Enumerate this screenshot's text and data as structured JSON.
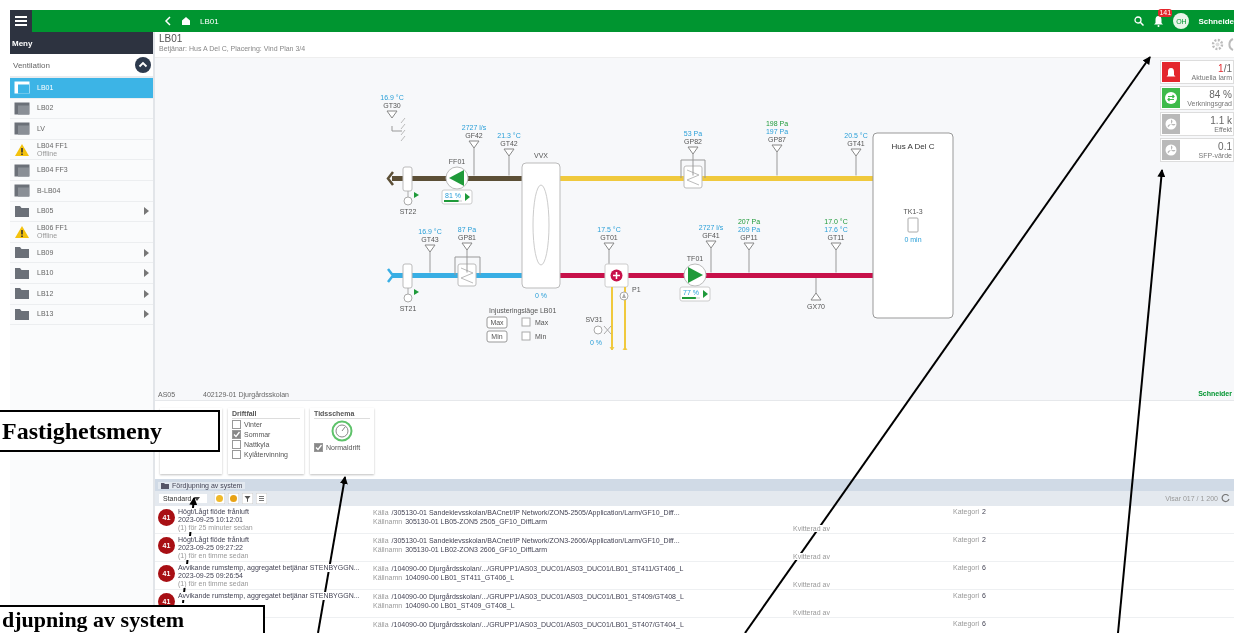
{
  "header": {
    "crumb": "LB01",
    "alarm_count": "141",
    "user_initials": "OH",
    "brand": "Schneide"
  },
  "sidebar": {
    "title": "Meny",
    "section": {
      "label": "Ventilation",
      "expanded": true
    },
    "items": [
      {
        "label": "LB01",
        "kind": "unit",
        "selected": true
      },
      {
        "label": "LB02",
        "kind": "unit",
        "selected": false
      },
      {
        "label": "LV",
        "kind": "unit",
        "selected": false
      },
      {
        "label": "LB04 FF1",
        "kind": "warning",
        "status": "Offline",
        "selected": false
      },
      {
        "label": "LB04 FF3",
        "kind": "unit",
        "selected": false
      },
      {
        "label": "B-LB04",
        "kind": "unit",
        "selected": false
      },
      {
        "label": "LB05",
        "kind": "folder",
        "selected": false
      },
      {
        "label": "LB06 FF1",
        "kind": "warning",
        "status": "Offline",
        "selected": false
      },
      {
        "label": "LB09",
        "kind": "folder",
        "selected": false
      },
      {
        "label": "LB10",
        "kind": "folder",
        "selected": false
      },
      {
        "label": "LB12",
        "kind": "folder",
        "selected": false
      },
      {
        "label": "LB13",
        "kind": "folder",
        "selected": false
      }
    ]
  },
  "page": {
    "title": "LB01",
    "subtitle": "Betjänar: Hus A Del C, Placering: Vind Plan 3/4"
  },
  "kpis": [
    {
      "kind": "alarm",
      "count": "1",
      "total": "/1",
      "label": "Aktuella larm"
    },
    {
      "kind": "recovery",
      "total": "84 %",
      "label": "Verkningsgrad"
    },
    {
      "kind": "fan",
      "total": "1.1 k",
      "label": "Effekt"
    },
    {
      "kind": "fan",
      "total": "0.1",
      "label": "SFP-värde"
    }
  ],
  "diagram": {
    "sensors": [
      {
        "tag": "GT30",
        "readings": [
          {
            "text": "16.9 °C",
            "kind": "measured"
          }
        ]
      },
      {
        "tag": "GF42",
        "readings": [
          {
            "text": "2727 l/s",
            "kind": "measured"
          }
        ]
      },
      {
        "tag": "GT42",
        "readings": [
          {
            "text": "21.3 °C",
            "kind": "measured"
          }
        ]
      },
      {
        "tag": "GP82",
        "readings": [
          {
            "text": "53 Pa",
            "kind": "measured"
          }
        ]
      },
      {
        "tag": "GP87",
        "readings": [
          {
            "text": "198 Pa",
            "kind": "setpoint"
          },
          {
            "text": "197 Pa",
            "kind": "measured"
          }
        ]
      },
      {
        "tag": "GT41",
        "readings": [
          {
            "text": "20.5 °C",
            "kind": "measured"
          }
        ]
      },
      {
        "tag": "GT43",
        "readings": [
          {
            "text": "16.9 °C",
            "kind": "measured"
          }
        ]
      },
      {
        "tag": "GP81",
        "readings": [
          {
            "text": "87 Pa",
            "kind": "measured"
          }
        ]
      },
      {
        "tag": "GT01",
        "readings": [
          {
            "text": "17.5 °C",
            "kind": "measured"
          }
        ]
      },
      {
        "tag": "GF41",
        "readings": [
          {
            "text": "2727 l/s",
            "kind": "measured"
          }
        ]
      },
      {
        "tag": "GP11",
        "readings": [
          {
            "text": "207 Pa",
            "kind": "setpoint"
          },
          {
            "text": "209 Pa",
            "kind": "measured"
          }
        ]
      },
      {
        "tag": "GT11",
        "readings": [
          {
            "text": "17.0 °C",
            "kind": "setpoint"
          },
          {
            "text": "17.6 °C",
            "kind": "measured"
          }
        ]
      }
    ],
    "fans": [
      {
        "tag": "FF01",
        "speed": "81 %",
        "level": 0.81
      },
      {
        "tag": "TF01",
        "speed": "77 %",
        "level": 0.77
      }
    ],
    "dampers": [
      {
        "tag": "ST22"
      },
      {
        "tag": "ST21"
      }
    ],
    "exchanger": {
      "tag": "VVX",
      "output": "0 %"
    },
    "valve": {
      "tag": "SV31",
      "output": "0 %"
    },
    "pump": {
      "tag": "P1"
    },
    "pressure_sensor": {
      "tag": "GX70"
    },
    "zone": {
      "name": "Hus A Del C",
      "tag": "TK1-3",
      "time": "0 min"
    },
    "balancing": {
      "title": "Injusteringsläge LB01",
      "buttons": [
        "Max",
        "Min"
      ],
      "options": [
        {
          "label": "Max",
          "checked": false
        },
        {
          "label": "Min",
          "checked": false
        }
      ]
    },
    "footer": [
      "AS05",
      "402129-01 Djurgårdsskolan"
    ],
    "brand": "Schneider"
  },
  "operating_modes": {
    "title": "Driftfall",
    "options": [
      {
        "label": "Vinter",
        "checked": false
      },
      {
        "label": "Sommar",
        "checked": true
      },
      {
        "label": "Nattkyla",
        "checked": false
      },
      {
        "label": "Kylåtervinning",
        "checked": false
      }
    ]
  },
  "schedule": {
    "title": "Tidsschema",
    "options": [
      {
        "label": "Normaldrift",
        "checked": true
      }
    ]
  },
  "alarm_panel": {
    "tab": "Fördjupning av system",
    "filter": "Standard",
    "count": "Visar 017 / 1 200",
    "rows": [
      {
        "badge": "41",
        "title": "Högt/Lågt flöde frånluft",
        "time": "2023-09-25 10:12:01",
        "ago": "(1) för 25 minuter sedan",
        "source_label": "Källa",
        "source": "/305130-01 Sandeklevsskolan/BACnet/IP Network/ZON5-2505/Application/Larm/GF10_Diff...",
        "name_label": "Källnamn",
        "name": "305130-01 LB05-ZON5 2505_GF10_DiffLarm",
        "ack_label": "Kvitterad av",
        "category_label": "Kategori",
        "category": "2"
      },
      {
        "badge": "41",
        "title": "Högt/Lågt flöde frånluft",
        "time": "2023-09-25 09:27:22",
        "ago": "(1) för en timme sedan",
        "source_label": "Källa",
        "source": "/305130-01 Sandeklevsskolan/BACnet/IP Network/ZON3-2606/Application/Larm/GF10_Diff...",
        "name_label": "Källnamn",
        "name": "305130-01 LB02-ZON3 2606_GF10_DiffLarm",
        "ack_label": "Kvitterad av",
        "category_label": "Kategori",
        "category": "2"
      },
      {
        "badge": "41",
        "title": "Avvikande rumstemp, aggregatet betjänar STENBYGGN...",
        "time": "2023-09-25 09:26:54",
        "ago": "(1) för en timme sedan",
        "source_label": "Källa",
        "source": "/104090-00 Djurgårdsskolan/.../GRUPP1/AS03_DUC01/AS03_DUC01/LB01_ST411/GT406_L",
        "name_label": "Källnamn",
        "name": "104090-00 LB01_ST411_GT406_L",
        "ack_label": "Kvitterad av",
        "category_label": "Kategori",
        "category": "6"
      },
      {
        "badge": "41",
        "title": "Avvikande rumstemp, aggregatet betjänar STENBYGGN...",
        "source_label": "Källa",
        "source": "/104090-00 Djurgårdsskolan/.../GRUPP1/AS03_DUC01/AS03_DUC01/LB01_ST409/GT408_L",
        "name_label": "Källnamn",
        "name": "104090-00 LB01_ST409_GT408_L",
        "ack_label": "Kvitterad av",
        "category_label": "Kategori",
        "category": "6"
      },
      {
        "source_label": "Källa",
        "source": "/104090-00 Djurgårdsskolan/.../GRUPP1/AS03_DUC01/AS03_DUC01/LB01_ST407/GT404_L",
        "category_label": "Kategori",
        "category": "6"
      }
    ]
  },
  "annotations": [
    {
      "text": "Fastighetsmeny"
    },
    {
      "text": "djupning av system"
    }
  ]
}
